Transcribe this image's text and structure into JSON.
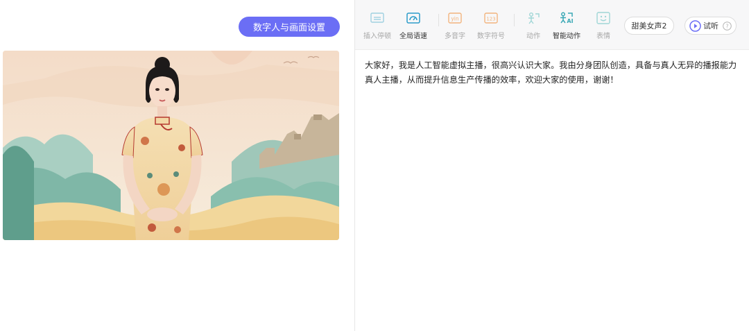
{
  "left_panel": {
    "settings_button_label": "数字人与画面设置"
  },
  "toolbar": {
    "items": [
      {
        "label": "插入停顿",
        "icon": "pause-insert-icon",
        "active": false
      },
      {
        "label": "全局语速",
        "icon": "speed-gauge-icon",
        "active": true
      },
      {
        "label": "多音字",
        "icon": "pinyin-icon",
        "active": false
      },
      {
        "label": "数字符号",
        "icon": "number-symbol-icon",
        "active": false
      },
      {
        "label": "动作",
        "icon": "gesture-icon",
        "active": false
      },
      {
        "label": "智能动作",
        "icon": "ai-gesture-icon",
        "active": true
      },
      {
        "label": "表情",
        "icon": "expression-icon",
        "active": false
      }
    ],
    "voice_label": "甜美女声2",
    "listen_label": "试听"
  },
  "script": {
    "line1": "大家好，我是人工智能虚拟主播，很高兴认识大家。我由分身团队创造，具备与真人无异的播报能力",
    "line2": "真人主播，从而提升信息生产传播的效率，欢迎大家的使用，谢谢！"
  },
  "colors": {
    "accent": "#6b6ef5",
    "toolbar_bg": "#f7f7f8",
    "teal_icon": "#4bb7c3",
    "orange_icon": "#f0a96a"
  }
}
